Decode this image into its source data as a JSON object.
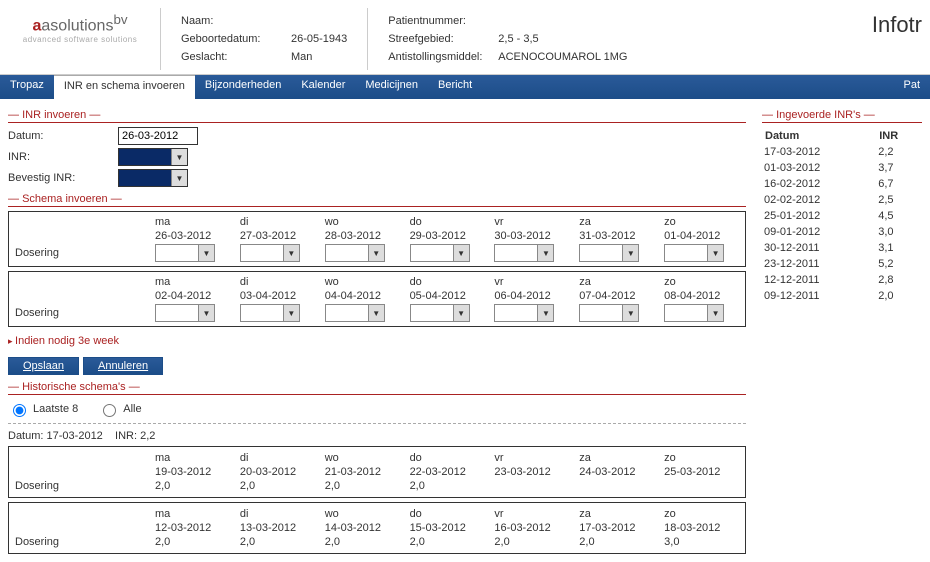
{
  "header": {
    "logo_main": "asolutions",
    "logo_sup": "bv",
    "logo_sub": "advanced software solutions",
    "naam_label": "Naam:",
    "naam_value": "",
    "geboortedatum_label": "Geboortedatum:",
    "geboortedatum_value": "26-05-1943",
    "geslacht_label": "Geslacht:",
    "geslacht_value": "Man",
    "patientnummer_label": "Patientnummer:",
    "patientnummer_value": "",
    "streefgebied_label": "Streefgebied:",
    "streefgebied_value": "2,5 - 3,5",
    "antistolling_label": "Antistollingsmiddel:",
    "antistolling_value": "ACENOCOUMAROL 1MG",
    "brand_right": "Infotr"
  },
  "nav": {
    "tabs": [
      "Tropaz",
      "INR en schema invoeren",
      "Bijzonderheden",
      "Kalender",
      "Medicijnen",
      "Bericht"
    ],
    "right": "Pat"
  },
  "sections": {
    "inr_invoeren": "INR invoeren",
    "schema_invoeren": "Schema invoeren",
    "historische": "Historische schema's",
    "ingevoerde": "Ingevoerde INR's"
  },
  "inr_form": {
    "datum_label": "Datum:",
    "datum_value": "26-03-2012",
    "inr_label": "INR:",
    "bevestig_label": "Bevestig INR:"
  },
  "schema": {
    "dosering_label": "Dosering",
    "days": [
      "ma",
      "di",
      "wo",
      "do",
      "vr",
      "za",
      "zo"
    ],
    "week1": [
      "26-03-2012",
      "27-03-2012",
      "28-03-2012",
      "29-03-2012",
      "30-03-2012",
      "31-03-2012",
      "01-04-2012"
    ],
    "week2": [
      "02-04-2012",
      "03-04-2012",
      "04-04-2012",
      "05-04-2012",
      "06-04-2012",
      "07-04-2012",
      "08-04-2012"
    ]
  },
  "link_3e_week": "Indien nodig 3e week",
  "buttons": {
    "opslaan": "Opslaan",
    "annuleren": "Annuleren"
  },
  "radio": {
    "laatste8": "Laatste 8",
    "alle": "Alle"
  },
  "historic": {
    "header_datum_lbl": "Datum:",
    "header_datum": "17-03-2012",
    "header_inr_lbl": "INR:",
    "header_inr": "2,2",
    "dosering_label": "Dosering",
    "days": [
      "ma",
      "di",
      "wo",
      "do",
      "vr",
      "za",
      "zo"
    ],
    "row1_dates": [
      "19-03-2012",
      "20-03-2012",
      "21-03-2012",
      "22-03-2012",
      "23-03-2012",
      "24-03-2012",
      "25-03-2012"
    ],
    "row1_vals": [
      "2,0",
      "2,0",
      "2,0",
      "2,0",
      "",
      "",
      ""
    ],
    "row2_dates": [
      "12-03-2012",
      "13-03-2012",
      "14-03-2012",
      "15-03-2012",
      "16-03-2012",
      "17-03-2012",
      "18-03-2012"
    ],
    "row2_vals": [
      "2,0",
      "2,0",
      "2,0",
      "2,0",
      "2,0",
      "2,0",
      "3,0"
    ]
  },
  "inr_history": {
    "datum_header": "Datum",
    "inr_header": "INR",
    "rows": [
      {
        "d": "17-03-2012",
        "v": "2,2"
      },
      {
        "d": "01-03-2012",
        "v": "3,7"
      },
      {
        "d": "16-02-2012",
        "v": "6,7"
      },
      {
        "d": "02-02-2012",
        "v": "2,5"
      },
      {
        "d": "25-01-2012",
        "v": "4,5"
      },
      {
        "d": "09-01-2012",
        "v": "3,0"
      },
      {
        "d": "30-12-2011",
        "v": "3,1"
      },
      {
        "d": "23-12-2011",
        "v": "5,2"
      },
      {
        "d": "12-12-2011",
        "v": "2,8"
      },
      {
        "d": "09-12-2011",
        "v": "2,0"
      }
    ]
  }
}
